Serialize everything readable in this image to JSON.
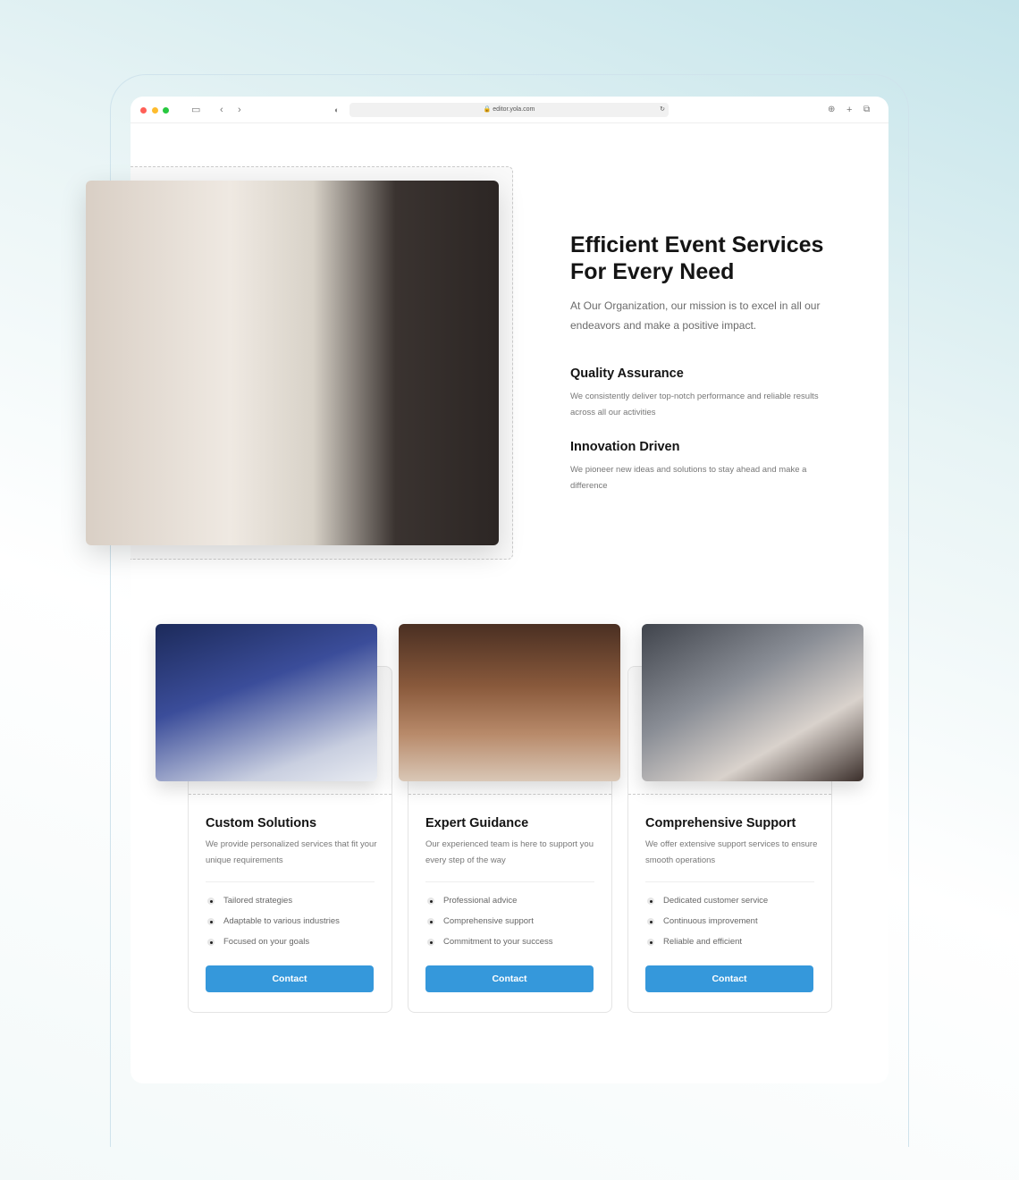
{
  "browser": {
    "url": "editor.yola.com",
    "dots": [
      "#ff5f57",
      "#febc2e",
      "#28c840"
    ]
  },
  "hero": {
    "title": "Efficient Event Services For Every Need",
    "intro": "At Our Organization, our mission is to excel in all our endeavors and make a positive impact.",
    "features": [
      {
        "title": "Quality Assurance",
        "text": "We consistently deliver top-notch performance and reliable results across all our activities"
      },
      {
        "title": "Innovation Driven",
        "text": "We pioneer new ideas and solutions to stay ahead and make a difference"
      }
    ]
  },
  "cards": [
    {
      "title": "Custom Solutions",
      "text": "We provide personalized services that fit your unique requirements",
      "items": [
        "Tailored strategies",
        "Adaptable to various industries",
        "Focused on your goals"
      ],
      "button": "Contact"
    },
    {
      "title": "Expert Guidance",
      "text": "Our experienced team is here to support you every step of the way",
      "items": [
        "Professional advice",
        "Comprehensive support",
        "Commitment to your success"
      ],
      "button": "Contact"
    },
    {
      "title": "Comprehensive Support",
      "text": "We offer extensive support services to ensure smooth operations",
      "items": [
        "Dedicated customer service",
        "Continuous improvement",
        "Reliable and efficient"
      ],
      "button": "Contact"
    }
  ],
  "accent": "#3598db"
}
